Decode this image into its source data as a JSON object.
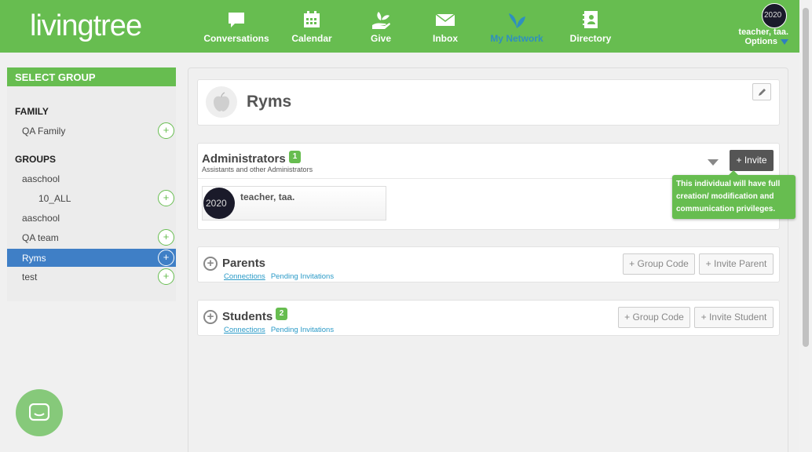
{
  "brand": {
    "logo": "livingtree"
  },
  "nav": [
    {
      "label": "Conversations",
      "icon": "chat-bubble-icon"
    },
    {
      "label": "Calendar",
      "icon": "calendar-icon"
    },
    {
      "label": "Give",
      "icon": "hand-plant-icon"
    },
    {
      "label": "Inbox",
      "icon": "envelope-icon"
    },
    {
      "label": "My Network",
      "icon": "leaf-network-icon",
      "active": true
    },
    {
      "label": "Directory",
      "icon": "directory-icon"
    }
  ],
  "user": {
    "avatar_text": "2020",
    "name": "teacher, taa.",
    "options_label": "Options"
  },
  "sidebar": {
    "header": "SELECT GROUP",
    "family_label": "FAMILY",
    "family_items": [
      {
        "label": "QA Family"
      }
    ],
    "groups_label": "GROUPS",
    "group_items": [
      {
        "label": "aaschool"
      },
      {
        "label": "10_ALL"
      },
      {
        "label": "aaschool"
      },
      {
        "label": "QA team"
      },
      {
        "label": "Ryms",
        "selected": true
      },
      {
        "label": "test"
      }
    ],
    "plus_glyph": "+"
  },
  "group": {
    "name": "Ryms"
  },
  "administrators": {
    "title": "Administrators",
    "count": "1",
    "subtitle": "Assistants and other Administrators",
    "invite_label": "+ Invite",
    "tooltip": "This individual will have full creation/ modification and communication privileges.",
    "members": [
      {
        "name": "teacher, taa.",
        "avatar_text": "2020"
      }
    ]
  },
  "parents": {
    "title": "Parents",
    "links": [
      "Connections",
      "Pending Invitations"
    ],
    "group_code_label": "+ Group Code",
    "invite_label": "+ Invite Parent"
  },
  "students": {
    "title": "Students",
    "count": "2",
    "links": [
      "Connections",
      "Pending Invitations"
    ],
    "group_code_label": "+ Group Code",
    "invite_label": "+ Invite Student"
  },
  "colors": {
    "brand_green": "#67bd50",
    "selected_blue": "#3f7fc6",
    "link_blue": "#2a9ac7"
  }
}
